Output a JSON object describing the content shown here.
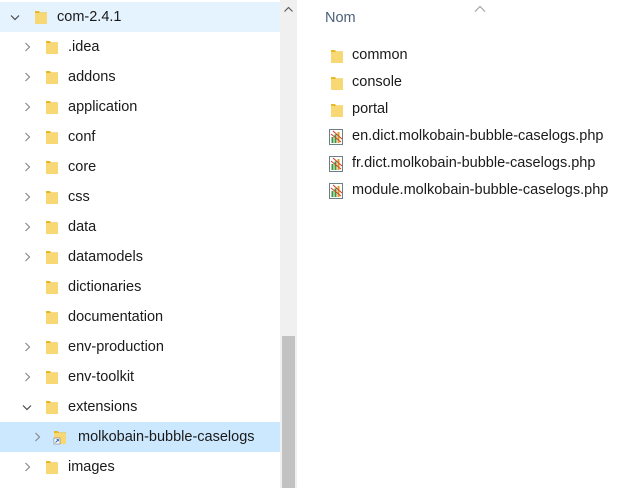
{
  "navigation_tree": {
    "root": {
      "label": "com-2.4.1",
      "icon": "folder-icon",
      "state": "expanded"
    },
    "items": [
      {
        "label": ".idea",
        "icon": "folder-icon",
        "expandable": true
      },
      {
        "label": "addons",
        "icon": "folder-icon",
        "expandable": true
      },
      {
        "label": "application",
        "icon": "folder-icon",
        "expandable": true
      },
      {
        "label": "conf",
        "icon": "folder-icon",
        "expandable": true
      },
      {
        "label": "core",
        "icon": "folder-icon",
        "expandable": true
      },
      {
        "label": "css",
        "icon": "folder-icon",
        "expandable": true
      },
      {
        "label": "data",
        "icon": "folder-icon",
        "expandable": true
      },
      {
        "label": "datamodels",
        "icon": "folder-icon",
        "expandable": true
      },
      {
        "label": "dictionaries",
        "icon": "folder-icon",
        "expandable": false
      },
      {
        "label": "documentation",
        "icon": "folder-icon",
        "expandable": false
      },
      {
        "label": "env-production",
        "icon": "folder-icon",
        "expandable": true
      },
      {
        "label": "env-toolkit",
        "icon": "folder-icon",
        "expandable": true
      },
      {
        "label": "extensions",
        "icon": "folder-icon",
        "expandable": true,
        "state": "expanded"
      },
      {
        "label": "molkobain-bubble-caselogs",
        "icon": "folder-shortcut-icon",
        "expandable": true,
        "selected": true
      },
      {
        "label": "images",
        "icon": "folder-icon",
        "expandable": true
      }
    ]
  },
  "content_pane": {
    "column_header": "Nom",
    "items": [
      {
        "label": "common",
        "type": "folder"
      },
      {
        "label": "console",
        "type": "folder"
      },
      {
        "label": "portal",
        "type": "folder"
      },
      {
        "label": "en.dict.molkobain-bubble-caselogs.php",
        "type": "php-file"
      },
      {
        "label": "fr.dict.molkobain-bubble-caselogs.php",
        "type": "php-file"
      },
      {
        "label": "module.molkobain-bubble-caselogs.php",
        "type": "php-file"
      }
    ]
  },
  "colors": {
    "folder": "#f8d775",
    "folder_dark": "#e8b923",
    "selected_background": "#cce8ff",
    "hover_background": "#e5f3ff",
    "header_text": "#4c607a"
  }
}
